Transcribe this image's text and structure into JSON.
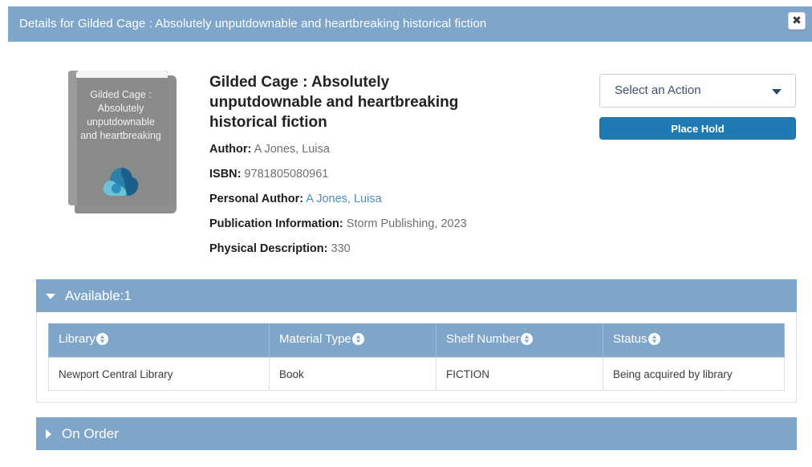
{
  "modal": {
    "title": "Details for Gilded Cage : Absolutely unputdownable and heartbreaking historical fiction",
    "close_icon": "close-icon",
    "close_glyph": "✖"
  },
  "cover": {
    "text": "Gilded Cage : Absolutely unputdownable and heartbreaking",
    "logo_icon": "cloud-logo-icon",
    "logo_color_dark": "#1f6f9c",
    "logo_color_light": "#7ec8dd",
    "background_color": "#8a8a8a"
  },
  "biblio": {
    "title": "Gilded Cage : Absolutely unputdownable and heartbreaking historical fiction",
    "rows": [
      {
        "label": "Author:",
        "value": "A Jones, Luisa",
        "is_link": false
      },
      {
        "label": "ISBN:",
        "value": "9781805080961",
        "is_link": false
      },
      {
        "label": "Personal Author:",
        "value": "A Jones, Luisa",
        "is_link": true
      },
      {
        "label": "Publication Information:",
        "value": "Storm Publishing, 2023",
        "is_link": false
      },
      {
        "label": "Physical Description:",
        "value": "330",
        "is_link": false
      }
    ]
  },
  "actions": {
    "select_label": "Select an Action",
    "select_caret_icon": "chevron-down-icon",
    "place_hold_label": "Place Hold",
    "place_hold_color": "#1f7ab4"
  },
  "panels": {
    "available": {
      "title": "Available:1",
      "expanded": true,
      "caret_icon": "caret-down-icon"
    },
    "on_order": {
      "title": "On Order",
      "expanded": false,
      "caret_icon": "caret-right-icon"
    }
  },
  "holdings_table": {
    "sort_icon": "sort-toggle-icon",
    "columns": [
      "Library",
      "Material Type",
      "Shelf Number",
      "Status"
    ],
    "rows": [
      {
        "library": "Newport Central Library",
        "material_type": "Book",
        "shelf_number": "FICTION",
        "status": "Being acquired by library"
      }
    ]
  },
  "theme": {
    "header_blue": "#7fa6c8",
    "link_blue": "#4a8fbd",
    "button_blue": "#1f7ab4"
  }
}
